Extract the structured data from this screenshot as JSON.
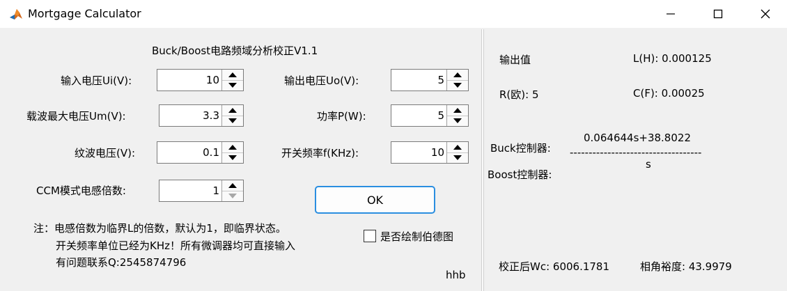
{
  "window": {
    "title": "Mortgage Calculator",
    "minimize_label": "—",
    "maximize_label": "☐",
    "close_label": "✕"
  },
  "left": {
    "heading": "Buck/Boost电路频域分析校正V1.1",
    "fields": {
      "ui": {
        "label": "输入电压Ui(V):",
        "value": "10"
      },
      "uo": {
        "label": "输出电压Uo(V):",
        "value": "5"
      },
      "um": {
        "label": "载波最大电压Um(V):",
        "value": "3.3"
      },
      "p": {
        "label": "功率P(W):",
        "value": "5"
      },
      "ripple": {
        "label": "纹波电压(V):",
        "value": "0.1"
      },
      "f": {
        "label": "开关频率f(KHz):",
        "value": "10"
      },
      "ccm": {
        "label": "CCM模式电感倍数:",
        "value": "1"
      }
    },
    "ok_label": "OK",
    "bode_checkbox_label": "是否绘制伯德图",
    "bode_checked": false,
    "notes": [
      "注：电感倍数为临界L的倍数，默认为1，即临界状态。",
      "开关频率单位已经为KHz！所有微调器均可直接输入",
      "有问题联系Q:2545874796"
    ],
    "signature": "hhb"
  },
  "right": {
    "output_title": "输出值",
    "L": "L(H): 0.000125",
    "R": "R(欧): 5",
    "C": "C(F): 0.00025",
    "buck_label": "Buck控制器:",
    "boost_label": "Boost控制器:",
    "tf_numerator": "0.064644s+38.8022",
    "tf_bar": "-----------------------------------",
    "tf_denominator": "s",
    "wc": "校正后Wc: 6006.1781",
    "phase_margin": "相角裕度: 43.9979"
  }
}
